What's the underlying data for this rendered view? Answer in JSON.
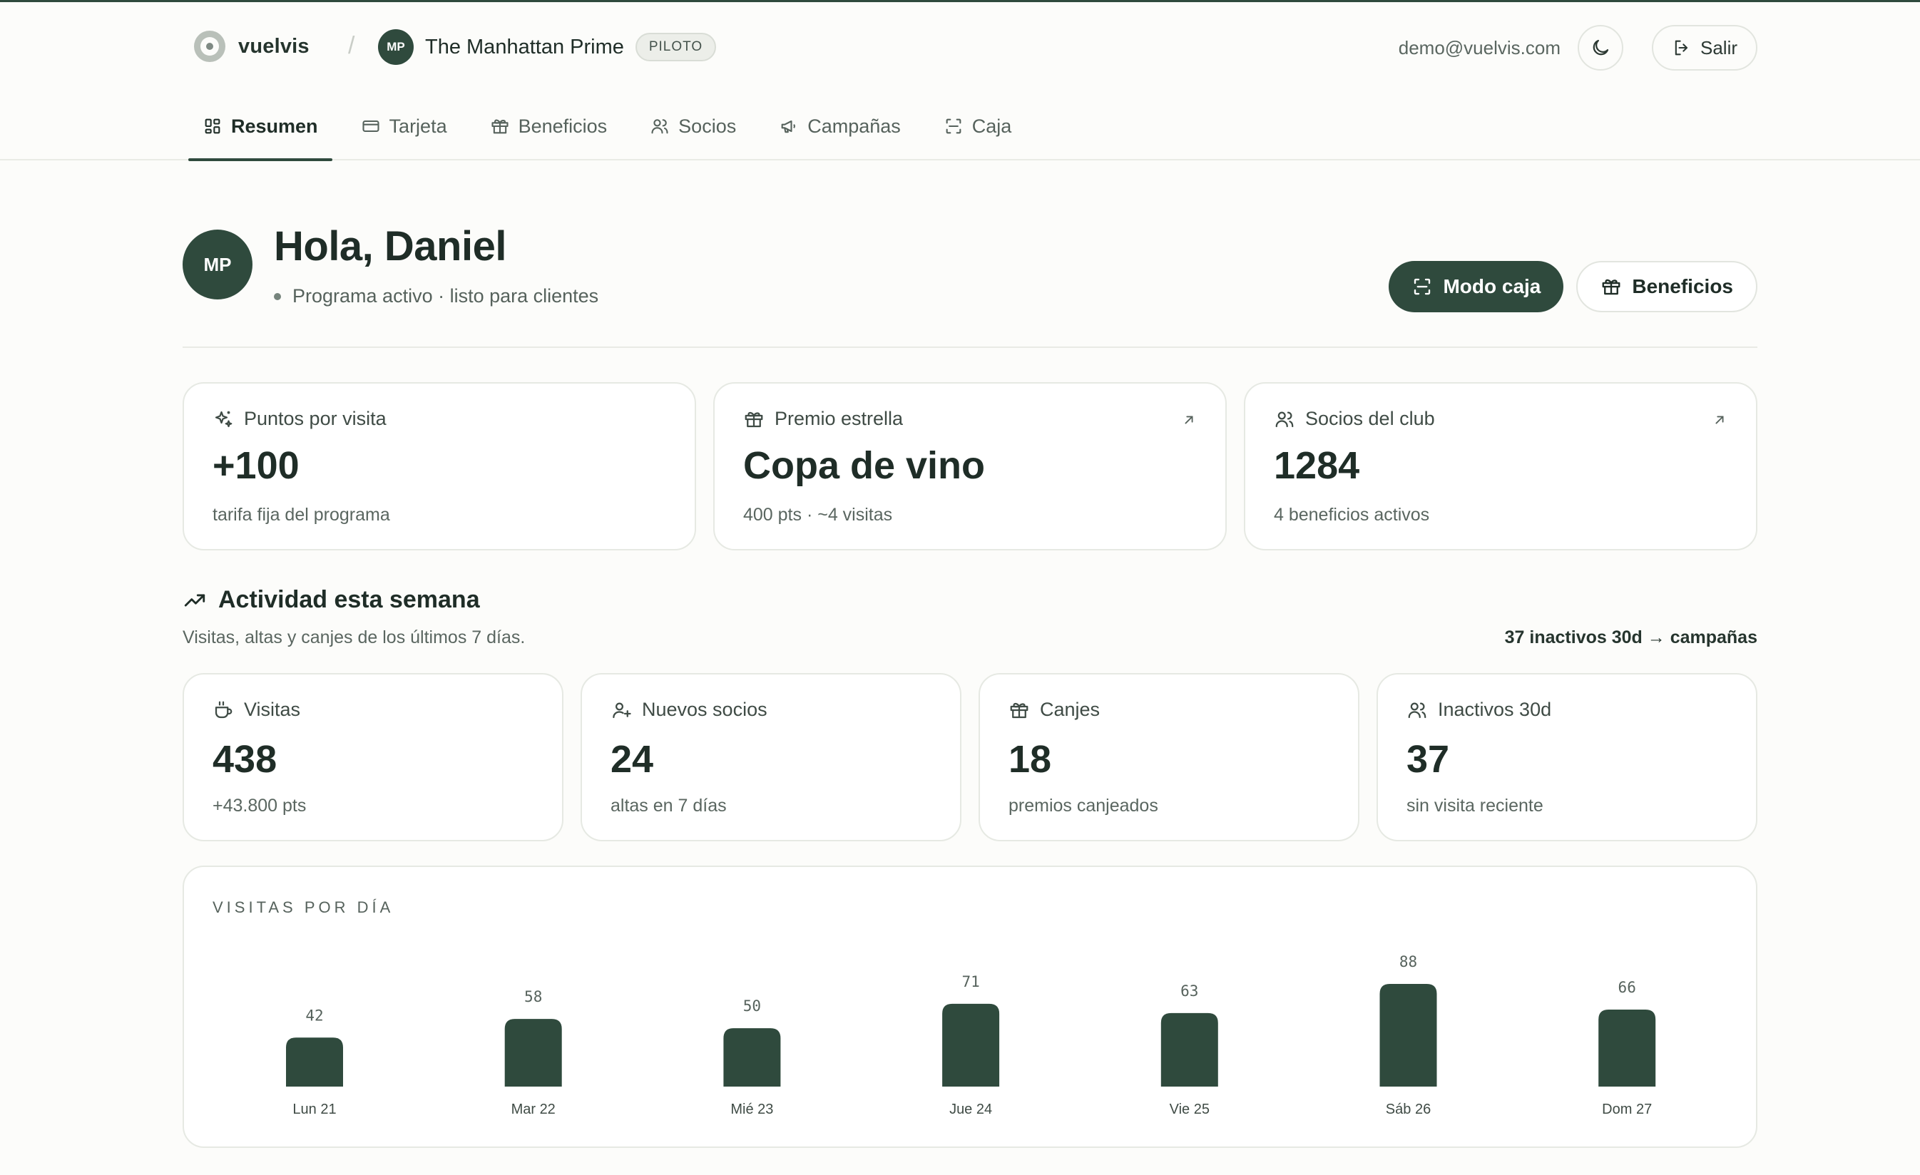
{
  "colors": {
    "accent": "#2f4a3d",
    "background": "#fcfcfa",
    "card": "#ffffff",
    "muted_text": "#5a6660"
  },
  "brand": {
    "name": "vuelvis",
    "logo_icon": "brand-logo"
  },
  "business": {
    "initials": "MP",
    "name": "The Manhattan Prime",
    "badge": "PILOTO"
  },
  "user": {
    "email": "demo@vuelvis.com",
    "theme_icon": "moon-icon",
    "logout_label": "Salir"
  },
  "tabs": [
    {
      "label": "Resumen",
      "icon": "dashboard-icon",
      "active": true
    },
    {
      "label": "Tarjeta",
      "icon": "card-icon",
      "active": false
    },
    {
      "label": "Beneficios",
      "icon": "gift-icon",
      "active": false
    },
    {
      "label": "Socios",
      "icon": "users-icon",
      "active": false
    },
    {
      "label": "Campañas",
      "icon": "megaphone-icon",
      "active": false
    },
    {
      "label": "Caja",
      "icon": "scan-icon",
      "active": false
    }
  ],
  "greeting": {
    "initials": "MP",
    "title": "Hola, Daniel",
    "status": "Programa activo · listo para clientes"
  },
  "actions": {
    "primary_label": "Modo caja",
    "secondary_label": "Beneficios"
  },
  "summary_cards": [
    {
      "icon": "sparkles-icon",
      "label": "Puntos por visita",
      "value": "+100",
      "sub": "tarifa fija del programa",
      "has_link": false
    },
    {
      "icon": "gift-icon",
      "label": "Premio estrella",
      "value": "Copa de vino",
      "sub": "400 pts · ~4 visitas",
      "has_link": true
    },
    {
      "icon": "users-icon",
      "label": "Socios del club",
      "value": "1284",
      "sub": "4 beneficios activos",
      "has_link": true
    }
  ],
  "activity": {
    "title": "Actividad esta semana",
    "subtitle": "Visitas, altas y canjes de los últimos 7 días.",
    "link": "37 inactivos 30d → campañas"
  },
  "stat_cards": [
    {
      "icon": "cup-icon",
      "label": "Visitas",
      "value": "438",
      "sub": "+43.800 pts"
    },
    {
      "icon": "user-plus-icon",
      "label": "Nuevos socios",
      "value": "24",
      "sub": "altas en 7 días"
    },
    {
      "icon": "gift-icon",
      "label": "Canjes",
      "value": "18",
      "sub": "premios canjeados"
    },
    {
      "icon": "users-icon",
      "label": "Inactivos 30d",
      "value": "37",
      "sub": "sin visita reciente"
    }
  ],
  "chart_data": {
    "type": "bar",
    "title": "VISITAS POR DÍA",
    "categories": [
      "Lun 21",
      "Mar 22",
      "Mié 23",
      "Jue 24",
      "Vie 25",
      "Sáb 26",
      "Dom 27"
    ],
    "values": [
      42,
      58,
      50,
      71,
      63,
      88,
      66
    ],
    "ylim": [
      0,
      88
    ],
    "grid": false,
    "legend": "none",
    "data_labels": true,
    "bar_color": "#2f4a3d"
  }
}
